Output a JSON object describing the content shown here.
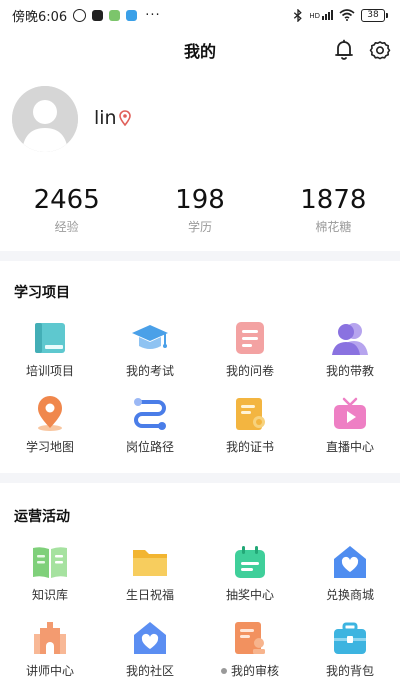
{
  "status_bar": {
    "time": "傍晚6:06",
    "dots": "···",
    "battery": "38",
    "network": "HD"
  },
  "header": {
    "title": "我的"
  },
  "profile": {
    "username": "lin"
  },
  "stats": [
    {
      "value": "2465",
      "label": "经验"
    },
    {
      "value": "198",
      "label": "学历"
    },
    {
      "value": "1878",
      "label": "棉花糖"
    }
  ],
  "learning": {
    "title": "学习项目",
    "items": [
      {
        "label": "培训项目",
        "icon": "book-icon"
      },
      {
        "label": "我的考试",
        "icon": "graduation-cap-icon"
      },
      {
        "label": "我的问卷",
        "icon": "questionnaire-icon"
      },
      {
        "label": "我的带教",
        "icon": "mentor-icon"
      },
      {
        "label": "学习地图",
        "icon": "map-pin-icon"
      },
      {
        "label": "岗位路径",
        "icon": "path-icon"
      },
      {
        "label": "我的证书",
        "icon": "certificate-icon"
      },
      {
        "label": "直播中心",
        "icon": "tv-icon"
      }
    ]
  },
  "operations": {
    "title": "运营活动",
    "items": [
      {
        "label": "知识库",
        "icon": "open-book-icon"
      },
      {
        "label": "生日祝福",
        "icon": "folder-icon"
      },
      {
        "label": "抽奖中心",
        "icon": "calendar-icon"
      },
      {
        "label": "兑换商城",
        "icon": "heart-home-icon"
      },
      {
        "label": "讲师中心",
        "icon": "castle-icon"
      },
      {
        "label": "我的社区",
        "icon": "community-icon"
      },
      {
        "label": "我的审核",
        "icon": "review-icon"
      },
      {
        "label": "我的背包",
        "icon": "backpack-icon"
      }
    ]
  }
}
